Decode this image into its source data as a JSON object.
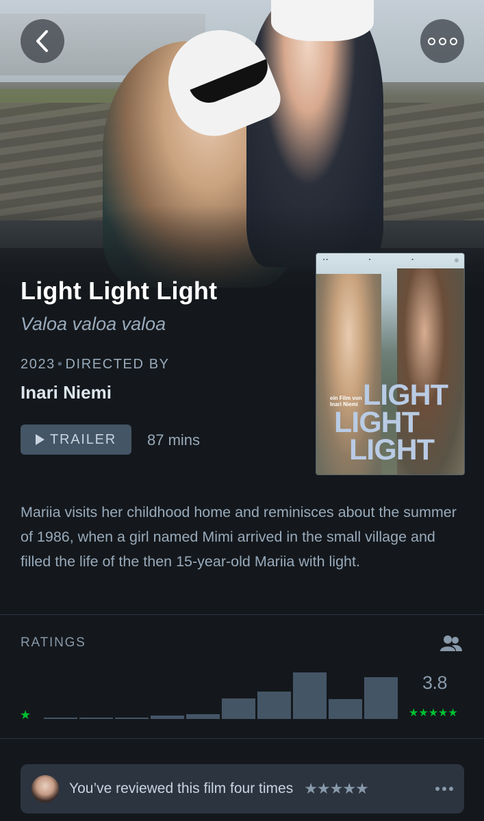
{
  "film": {
    "title": "Light Light Light",
    "original_title": "Valoa valoa valoa",
    "year": "2023",
    "directed_by_label": "DIRECTED BY",
    "director": "Inari Niemi",
    "trailer_label": "TRAILER",
    "runtime": "87 mins",
    "synopsis": "Mariia visits her childhood home and reminisces about the summer of 1986, when a girl named Mimi arrived in the small village and filled the life of the then 15-year-old Mariia with light."
  },
  "poster": {
    "credit_line1": "ein Film von",
    "credit_line2": "Inari Niemi",
    "words": [
      "LIGHT",
      "LIGHT",
      "LIGHT"
    ]
  },
  "nav": {
    "back_icon": "chevron-left-icon",
    "more_icon": "more-horizontal-icon"
  },
  "ratings": {
    "label": "RATINGS",
    "average": "3.8",
    "min_star": "★",
    "max_stars": "★★★★★",
    "histogram": [
      0.01,
      0.01,
      0.01,
      0.05,
      0.08,
      0.33,
      0.44,
      0.75,
      0.32,
      0.68
    ],
    "star_color": "#00c030",
    "bar_color": "#445566"
  },
  "review": {
    "text": "You’ve reviewed this film four times",
    "stars": "★★★★★"
  },
  "colors": {
    "background": "#14181c",
    "muted_text": "#99aabb",
    "panel": "#2c3440"
  }
}
